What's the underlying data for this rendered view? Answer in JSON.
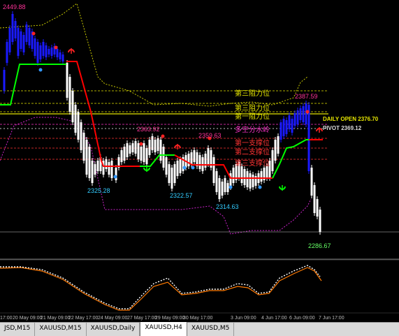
{
  "colors": {
    "up_candle": "#ffffff",
    "down_candle": "#ffffff",
    "trend_up": "#00ff00",
    "trend_down": "#ff0000",
    "blue_bars": "#1a1aff",
    "resistance": "#e6e600",
    "pivot": "#ff4b4b",
    "support": "#ff0000",
    "magenta": "#ff33cc",
    "price_label_high": "#ff3399",
    "price_label_low": "#33ccff",
    "osc_fast": "#ffffff",
    "osc_slow": "#ff7700"
  },
  "labels": {
    "high_top": "2449.88",
    "r3": "第三阻力位",
    "r2": "第三阻力位",
    "r1": "第一阻力位",
    "pivot_cn": "多空分水岭",
    "s1": "第一支撑位",
    "s2": "第二支撑位",
    "s3": "第三支撑位",
    "daily_open": "DAILY OPEN 2376.70",
    "pivot_en": "PIVOT 2369.12",
    "hi_2387": "2387.59",
    "hi_2363": "2363.92",
    "hi_2359": "2359.63",
    "lo_2325": "2325.28",
    "lo_2322": "2322.57",
    "lo_2314": "2314.63",
    "lo_2286": "2286.67"
  },
  "time_axis": [
    "17:00",
    "20 May 09:00",
    "21 May 09:00",
    "22 May 17:00",
    "24 May 09:00",
    "27 May 17:00",
    "29 May 09:00",
    "30 May 17:00",
    "3 Jun 09:00",
    "4 Jun 17:00",
    "6 Jun 09:00",
    "7 Jun 17:00"
  ],
  "tabs": [
    "JSD,M15",
    "XAUUSD,M15",
    "XAUUSD,Daily",
    "XAUUSD,H4",
    "XAUUSD,M5"
  ],
  "active_tab": "XAUUSD,H4",
  "icons": [
    "red-up-arrow-icon",
    "green-up-arrow-icon"
  ]
}
